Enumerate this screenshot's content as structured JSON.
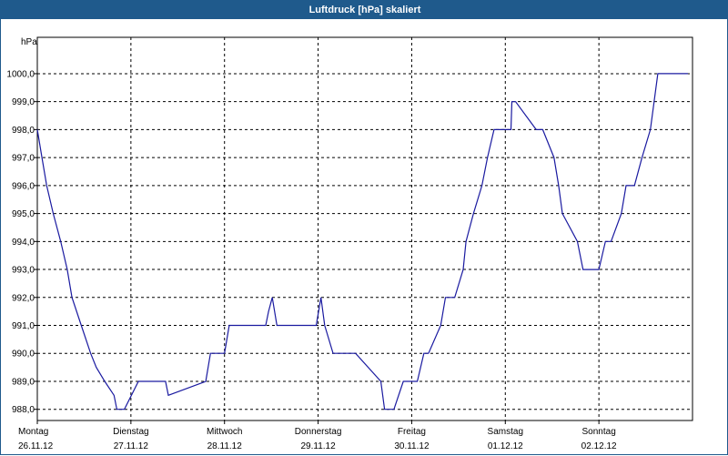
{
  "window": {
    "title": "Luftdruck [hPa] skaliert"
  },
  "chart_data": {
    "type": "line",
    "title": "Luftdruck [hPa] skaliert",
    "ylabel": "hPa",
    "xlabel": "",
    "ylim": [
      987.6,
      1001.3
    ],
    "yticks": [
      "988,0",
      "989,0",
      "990,0",
      "991,0",
      "992,0",
      "993,0",
      "994,0",
      "995,0",
      "996,0",
      "997,0",
      "998,0",
      "999,0",
      "1000,0"
    ],
    "ytick_values": [
      988,
      989,
      990,
      991,
      992,
      993,
      994,
      995,
      996,
      997,
      998,
      999,
      1000
    ],
    "xlim": [
      0,
      7
    ],
    "x_unit": "days from Montag 26.11.12 00:00",
    "xticks": [
      {
        "day": "Montag",
        "date": "26.11.12"
      },
      {
        "day": "Dienstag",
        "date": "27.11.12"
      },
      {
        "day": "Mittwoch",
        "date": "28.11.12"
      },
      {
        "day": "Donnerstag",
        "date": "29.11.12"
      },
      {
        "day": "Freitag",
        "date": "30.11.12"
      },
      {
        "day": "Samstag",
        "date": "01.12.12"
      },
      {
        "day": "Sonntag",
        "date": "02.12.12"
      }
    ],
    "grid": true,
    "line_color": "#1a1aa0",
    "series": [
      {
        "x": [
          0,
          0.05,
          0.1,
          0.17,
          0.25,
          0.32,
          0.37,
          0.47,
          0.57,
          0.63,
          0.72,
          0.82,
          0.85,
          0.87,
          0.93,
          1.08,
          1.14,
          1.16,
          1.2,
          1.37,
          1.4,
          1.8,
          1.85,
          1.94,
          1.97,
          2.0,
          2.05,
          2.44,
          2.47,
          2.51,
          2.56,
          2.62,
          2.67,
          2.98,
          3.03,
          3.07,
          3.16,
          3.33,
          3.4,
          3.67,
          3.71,
          3.81,
          3.91,
          3.94,
          4.06,
          4.13,
          4.18,
          4.31,
          4.36,
          4.46,
          4.55,
          4.58,
          4.66,
          4.75,
          4.81,
          4.88,
          5.0,
          5.04,
          5.06,
          5.07,
          5.11,
          5.33,
          5.4,
          5.52,
          5.57,
          5.61,
          5.77,
          5.83,
          5.88,
          6.0,
          6.07,
          6.13,
          6.24,
          6.29,
          6.34,
          6.38,
          6.46,
          6.55,
          6.59,
          6.63,
          6.75,
          6.82,
          6.88,
          6.95
        ],
        "y": [
          998.0,
          997.0,
          996.0,
          995.0,
          994.0,
          993.0,
          992.0,
          991.0,
          990.0,
          989.5,
          989.0,
          988.5,
          988.0,
          988.0,
          988.0,
          989.0,
          989.0,
          989.0,
          989.0,
          989.0,
          988.5,
          989.0,
          990.0,
          990.0,
          990.0,
          990.0,
          991.0,
          991.0,
          991.5,
          992.0,
          991.0,
          991.0,
          991.0,
          991.0,
          992.0,
          991.0,
          990.0,
          990.0,
          990.0,
          989.0,
          988.0,
          988.0,
          989.0,
          989.0,
          989.0,
          990.0,
          990.0,
          991.0,
          992.0,
          992.0,
          993.0,
          994.0,
          995.0,
          996.0,
          997.0,
          998.0,
          998.0,
          998.0,
          998.0,
          999.0,
          999.0,
          998.0,
          998.0,
          997.0,
          996.0,
          995.0,
          994.0,
          993.0,
          993.0,
          993.0,
          994.0,
          994.0,
          995.0,
          996.0,
          996.0,
          996.0,
          997.0,
          998.0,
          999.0,
          1000.0,
          1000.0,
          1000.0,
          1000.0,
          1000.0
        ]
      }
    ]
  }
}
